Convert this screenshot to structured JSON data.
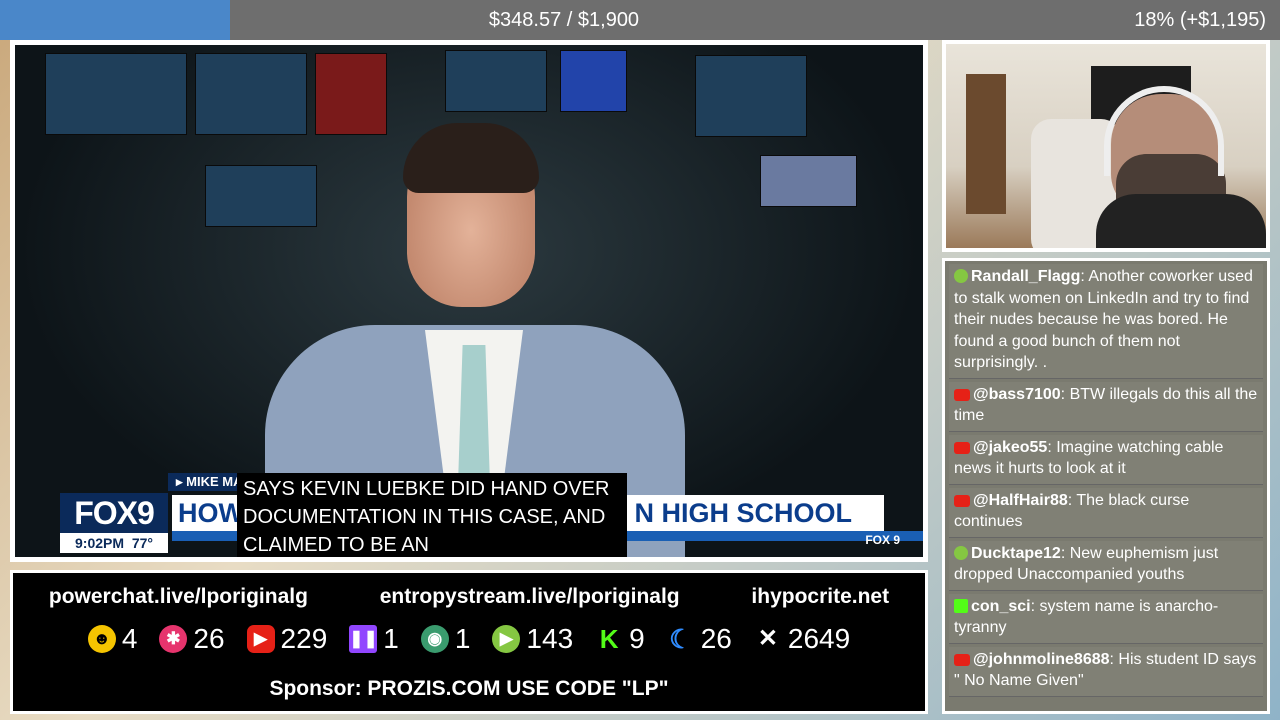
{
  "goal_bar": {
    "amount_text": "$348.57 / $1,900",
    "percent_text": "18% (+$1,195)",
    "progress_fraction": 0.18
  },
  "news": {
    "reporter_tag": "▸ MIKE MA",
    "logo": "FOX9",
    "time": "9:02PM",
    "temp": "77°",
    "headline": "HOW",
    "headline_tail": "N HIGH SCHOOL",
    "corner_logo": "FOX 9",
    "captions": [
      "SAYS KEVIN LUEBKE DID HAND OVER",
      "DOCUMENTATION IN THIS CASE, AND",
      "CLAIMED TO BE AN"
    ]
  },
  "links": [
    "powerchat.live/lporiginalg",
    "entropystream.live/lporiginalg",
    "ihypocrite.net"
  ],
  "counters": [
    {
      "icon": "smiley-icon",
      "value": "4",
      "color": "#f5c400"
    },
    {
      "icon": "rumble-x-icon",
      "value": "26",
      "color": "#e6346d"
    },
    {
      "icon": "youtube-icon",
      "value": "229",
      "color": "#e62117"
    },
    {
      "icon": "twitch-icon",
      "value": "1",
      "color": "#9146ff"
    },
    {
      "icon": "globe-icon",
      "value": "1",
      "color": "#3a9b6e"
    },
    {
      "icon": "rumble-icon",
      "value": "143",
      "color": "#85c742"
    },
    {
      "icon": "kick-icon",
      "value": "9",
      "color": "#53fc18"
    },
    {
      "icon": "moon-icon",
      "value": "26",
      "color": "#2f8cff"
    },
    {
      "icon": "x-icon",
      "value": "2649",
      "color": "#ffffff"
    }
  ],
  "sponsor": "Sponsor: PROZIS.COM USE CODE \"LP\"",
  "chat": [
    {
      "platform": "rumble",
      "user": "Randall_Flagg",
      "text": ": Another coworker used to stalk women on LinkedIn and try to find their nudes because he was bored. He found a good bunch of them not surprisingly. ."
    },
    {
      "platform": "youtube",
      "user": "@bass7100",
      "text": ": BTW illegals do this all the time"
    },
    {
      "platform": "youtube",
      "user": "@jakeo55",
      "text": ": Imagine watching cable news it hurts to look at it"
    },
    {
      "platform": "youtube",
      "user": "@HalfHair88",
      "text": ": The black curse continues"
    },
    {
      "platform": "rumble",
      "user": "Ducktape12",
      "text": ": New euphemism just dropped Unaccompanied youths"
    },
    {
      "platform": "kick",
      "user": "con_sci",
      "text": ": system name is anarcho-tyranny"
    },
    {
      "platform": "youtube",
      "user": "@johnmoline8688",
      "text": ": His student ID says \" No Name Given\""
    }
  ]
}
